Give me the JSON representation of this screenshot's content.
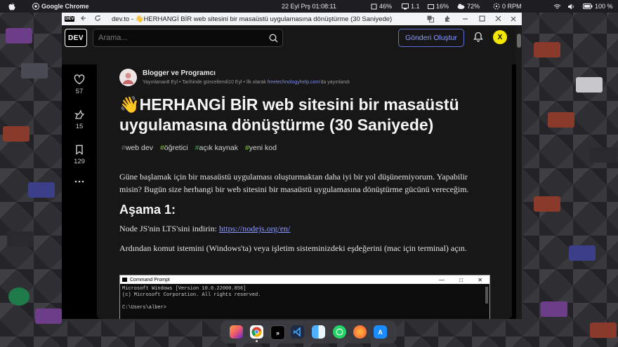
{
  "menubar": {
    "app_name": "Google Chrome",
    "datetime": "22 Eyl Prş  01:08:11",
    "cpu": "46%",
    "display_stat": "1.1",
    "mem": "16%",
    "weather": "72%",
    "fan": "0 RPM",
    "battery": "100 %"
  },
  "browser": {
    "url_text": "dev.to - 👋HERHANGİ BİR web sitesini bir masaüstü uygulamasına dönüştürme (30 Saniyede) - DEV..."
  },
  "header": {
    "logo": "DEV",
    "search_placeholder": "Arama...",
    "create_button": "Gönderi Oluştur",
    "avatar_letter": "X"
  },
  "reactions": [
    {
      "icon": "heart-icon",
      "count": "57"
    },
    {
      "icon": "unicorn-icon",
      "count": "15"
    },
    {
      "icon": "bookmark-icon",
      "count": "129"
    }
  ],
  "article": {
    "author": "Blogger ve Programcı",
    "meta_prefix": "Yayınlanan8 Eyl • Tarihinde güncellendi10 Eyl • İlk olarak ",
    "meta_link": "freetechnologyhelp.com",
    "meta_suffix": "'da yayınlandı",
    "title": "👋HERHANGİ BİR web sitesini bir masaüstü uygulamasına dönüştürme (30 Saniyede)",
    "tags": [
      {
        "hash": "#",
        "name": "web dev",
        "color": "#6e6e6e"
      },
      {
        "hash": "#",
        "name": "öğretici",
        "color": "#86c232"
      },
      {
        "hash": "#",
        "name": "açık kaynak",
        "color": "#36b24a"
      },
      {
        "hash": "#",
        "name": "yeni kod",
        "color": "#7bd32e"
      }
    ],
    "intro": "Güne başlamak için bir masaüstü uygulaması oluşturmaktan daha iyi bir yol düşünemiyorum. Yapabilir misin? Bugün size herhangi bir web sitesini bir masaüstü uygulamasına dönüştürme gücünü vereceğim.",
    "step_heading": "Aşama 1:",
    "step1_prefix": "Node JS'nin LTS'sini indirin: ",
    "step1_link": "https://nodejs.org/en/",
    "step2": "Ardından komut istemini (Windows'ta) veya işletim sisteminizdeki eşdeğerini (mac için terminal) açın."
  },
  "cmd": {
    "title": "Command Prompt",
    "line1": "Microsoft Windows [Version 10.0.22000.856]",
    "line2": "(c) Microsoft Corporation. All rights reserved.",
    "line3": "",
    "line4": "C:\\Users\\alber>"
  },
  "colors": {
    "accent": "#8d9bff",
    "dev_bg": "#000000",
    "card_bg": "#171717"
  }
}
